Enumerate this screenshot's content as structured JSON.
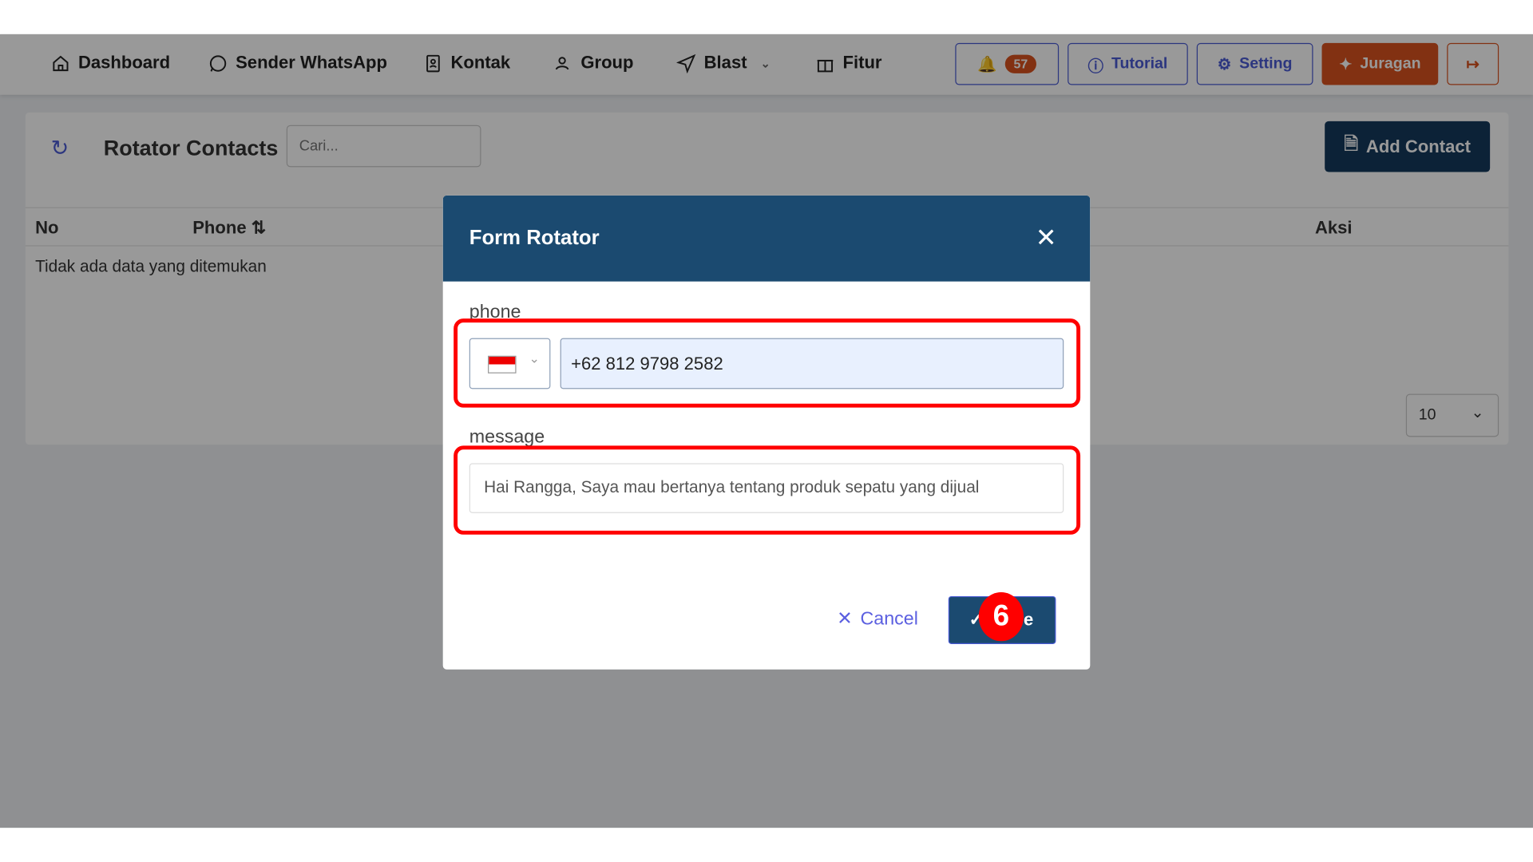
{
  "nav": {
    "items": [
      {
        "label": "Dashboard",
        "icon": "home-icon"
      },
      {
        "label": "Sender WhatsApp",
        "icon": "whatsapp-icon"
      },
      {
        "label": "Kontak",
        "icon": "contact-book-icon"
      },
      {
        "label": "Group",
        "icon": "users-icon"
      },
      {
        "label": "Blast",
        "icon": "send-icon"
      },
      {
        "label": "Fitur",
        "icon": "gift-icon"
      }
    ],
    "notification_count": "57",
    "tutorial": "Tutorial",
    "setting": "Setting",
    "juragan": "Juragan"
  },
  "colors": {
    "accent": "#4a5bd4",
    "primary": "#1b4a70",
    "orange": "#d9531e",
    "highlight": "#ff0000"
  },
  "page": {
    "title": "Rotator Contacts",
    "search_placeholder": "Cari...",
    "add_contact": "Add Contact",
    "table": {
      "columns": [
        "No",
        "Phone",
        "Aksi"
      ],
      "empty": "Tidak ada data yang ditemukan"
    },
    "page_size": "10"
  },
  "modal": {
    "title": "Form Rotator",
    "phone_label": "phone",
    "country": "ID",
    "phone_value": "+62 812 9798 2582",
    "message_label": "message",
    "message_value": "Hai Rangga, Saya mau bertanya tentang produk sepatu yang dijual",
    "cancel": "Cancel",
    "save_partial": "e",
    "step": "6"
  }
}
